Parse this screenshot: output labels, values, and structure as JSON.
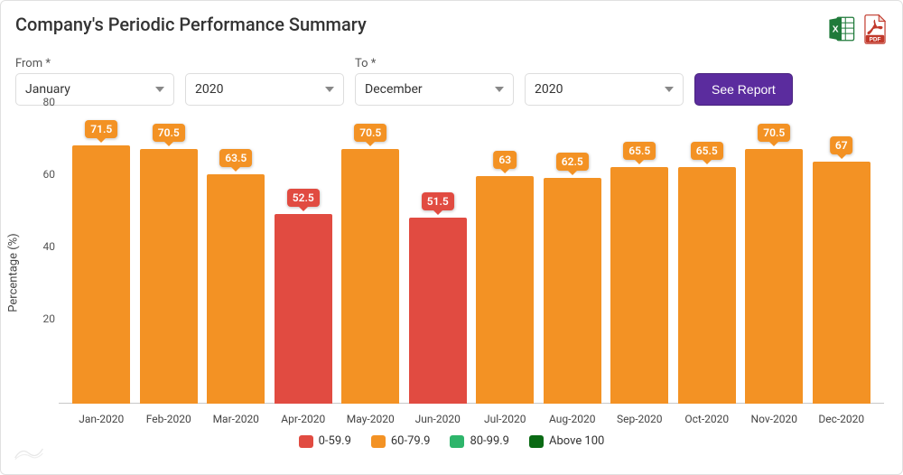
{
  "title": "Company's Periodic Performance Summary",
  "filters": {
    "from_label": "From *",
    "to_label": "To *",
    "from_month": "January",
    "from_year": "2020",
    "to_month": "December",
    "to_year": "2020",
    "button_label": "See Report"
  },
  "chart_data": {
    "type": "bar",
    "title": "Company's Periodic Performance Summary",
    "xlabel": "",
    "ylabel": "Percentage (%)",
    "ylim": [
      0,
      80
    ],
    "yticks": [
      20,
      40,
      60,
      80
    ],
    "categories": [
      "Jan-2020",
      "Feb-2020",
      "Mar-2020",
      "Apr-2020",
      "May-2020",
      "Jun-2020",
      "Jul-2020",
      "Aug-2020",
      "Sep-2020",
      "Oct-2020",
      "Nov-2020",
      "Dec-2020"
    ],
    "values": [
      71.5,
      70.5,
      63.5,
      52.5,
      70.5,
      51.5,
      63,
      62.5,
      65.5,
      65.5,
      70.5,
      67
    ],
    "bucket": [
      "60-79.9",
      "60-79.9",
      "60-79.9",
      "0-59.9",
      "60-79.9",
      "0-59.9",
      "60-79.9",
      "60-79.9",
      "60-79.9",
      "60-79.9",
      "60-79.9",
      "60-79.9"
    ],
    "color_map": {
      "0-59.9": "#e14b41",
      "60-79.9": "#f39224",
      "80-99.9": "#2eb56b",
      "Above 100": "#0a6a14"
    }
  },
  "legend": [
    {
      "label": "0-59.9",
      "class": "sw-red"
    },
    {
      "label": "60-79.9",
      "class": "sw-orange"
    },
    {
      "label": "80-99.9",
      "class": "sw-lgreen"
    },
    {
      "label": "Above 100",
      "class": "sw-dgreen"
    }
  ]
}
